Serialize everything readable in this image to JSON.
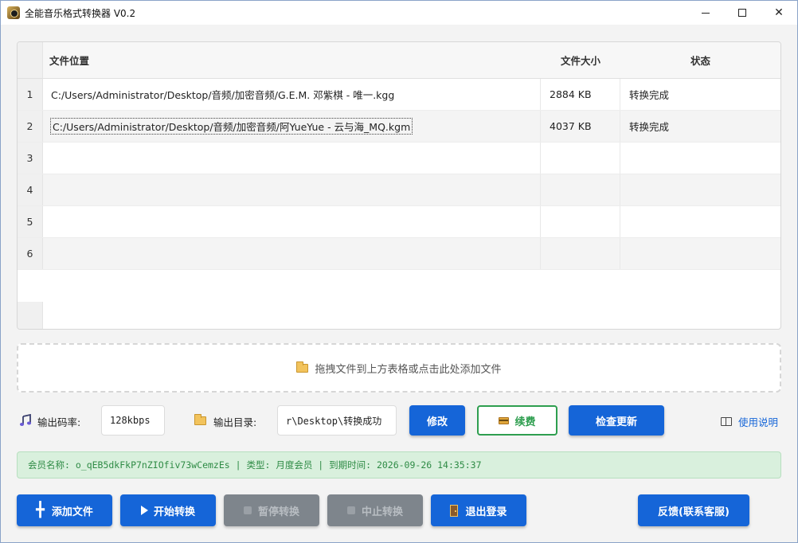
{
  "window": {
    "title": "全能音乐格式转换器 V0.2",
    "minimize_glyph": "",
    "maximize_glyph": "",
    "close_glyph": "✕"
  },
  "table": {
    "columns": [
      "文件位置",
      "文件大小",
      "状态"
    ],
    "rows": [
      {
        "num": "1",
        "path": "C:/Users/Administrator/Desktop/音频/加密音频/G.E.M. 邓紫棋 - 唯一.kgg",
        "size": "2884 KB",
        "status": "转换完成"
      },
      {
        "num": "2",
        "path": "C:/Users/Administrator/Desktop/音频/加密音频/阿YueYue - 云与海_MQ.kgm",
        "size": "4037 KB",
        "status": "转换完成"
      },
      {
        "num": "3",
        "path": "",
        "size": "",
        "status": ""
      },
      {
        "num": "4",
        "path": "",
        "size": "",
        "status": ""
      },
      {
        "num": "5",
        "path": "",
        "size": "",
        "status": ""
      },
      {
        "num": "6",
        "path": "",
        "size": "",
        "status": ""
      }
    ]
  },
  "dropzone": {
    "text": "拖拽文件到上方表格或点击此处添加文件",
    "icon": "folder-icon"
  },
  "settings": {
    "bitrate_label": "输出码率:",
    "bitrate_value": "128kbps",
    "output_dir_label": "输出目录:",
    "output_dir_value": "r\\Desktop\\转换成功",
    "modify_label": "修改",
    "renew_label": "续费",
    "check_update_label": "检查更新",
    "help_label": "使用说明"
  },
  "member": {
    "text": "会员名称: o_qEB5dkFkP7nZIOfiv73wCemzEs | 类型: 月度会员 | 到期时间: 2026-09-26 14:35:37"
  },
  "actions": {
    "add_files": "添加文件",
    "start": "开始转换",
    "pause": "暂停转换",
    "stop": "中止转换",
    "logout": "退出登录",
    "feedback": "反馈(联系客服)"
  },
  "colors": {
    "primary": "#1565d8",
    "success": "#2e9e4f",
    "disabled": "#7e858c",
    "member_bg": "#d9f0dd"
  }
}
